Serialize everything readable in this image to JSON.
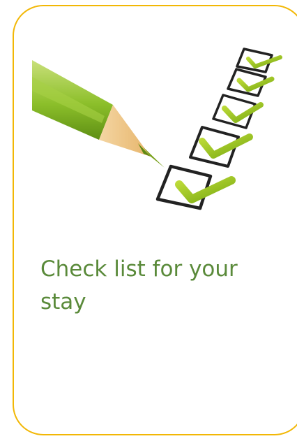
{
  "card": {
    "caption": "Check list for your stay",
    "border_color": "#f2b705",
    "text_color": "#5a8a3a"
  },
  "illustration": {
    "pencil_icon": "pencil-icon",
    "checkbox_icon": "checked-checkbox-icon",
    "checked_items": 5
  }
}
